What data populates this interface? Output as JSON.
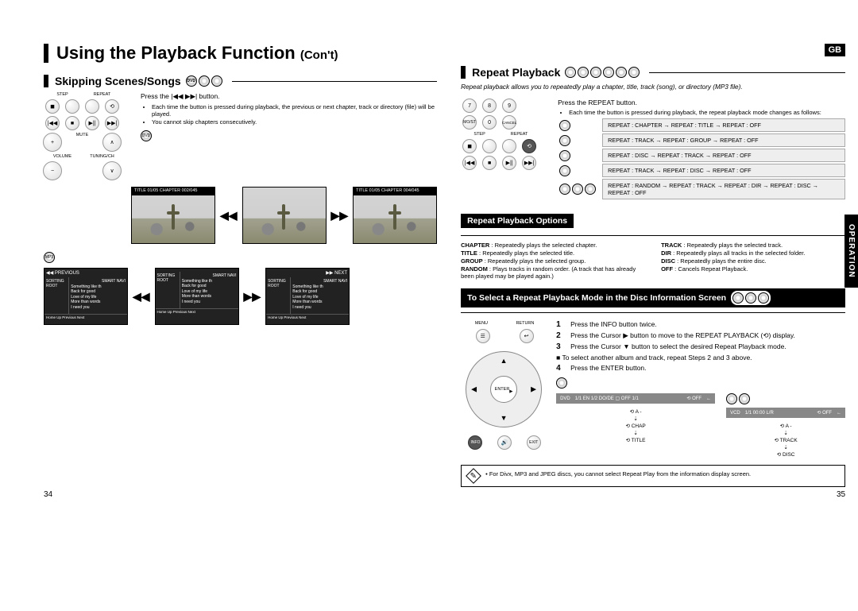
{
  "header": {
    "title": "Using the Playback Function",
    "cont": "(Con't)",
    "gb": "GB",
    "operation": "OPERATION"
  },
  "skip": {
    "heading": "Skipping Scenes/Songs",
    "press": "Press the |◀◀ ▶▶| button.",
    "bullet1": "Each time the button is pressed during playback, the previous or next chapter, track or directory (file) will be played.",
    "bullet2": "You cannot skip chapters consecutively.",
    "barTitle1": "TITLE 01/05 CHAPTER 002/045",
    "barTitle2": "TITLE 01/05 CHAPTER 004/045",
    "prevLabel": "◀◀ PREVIOUS",
    "nextLabel": "▶▶ NEXT",
    "menuCat1": "SORTING",
    "menuCat2": "ROOT",
    "menuCat3": "SMART NAVI",
    "menuItem1": "Something like th",
    "menuItem2": "Back for good",
    "menuItem3": "Love of my life",
    "menuItem4": "More than words",
    "menuItem5": "I need you",
    "menuFooter": "Home    Up    Previous    Next"
  },
  "repeat": {
    "heading": "Repeat Playback",
    "intro": "Repeat playback allows you to repeatedly play a chapter, title, track (song), or directory (MP3 file).",
    "press": "Press the REPEAT button.",
    "bullet1": "Each time the button is pressed during playback, the repeat playback mode changes as follows:",
    "seq1": "REPEAT : CHAPTER → REPEAT : TITLE → REPEAT : OFF",
    "seq2": "REPEAT : TRACK → REPEAT : GROUP → REPEAT : OFF",
    "seq3": "REPEAT : DISC → REPEAT : TRACK → REPEAT : OFF",
    "seq4": "REPEAT : TRACK → REPEAT : DISC → REPEAT : OFF",
    "seq5": "REPEAT : RANDOM → REPEAT : TRACK → REPEAT : DIR → REPEAT : DISC → REPEAT : OFF",
    "optionsHeading": "Repeat Playback Options",
    "opt_chapter": "Repeatedly plays the selected chapter.",
    "opt_title": "Repeatedly plays the selected title.",
    "opt_group": "Repeatedly plays the selected group.",
    "opt_random": "Plays tracks in random order. (A track that has already been played may be played again.)",
    "opt_track": "Repeatedly plays the selected track.",
    "opt_dir": "Repeatedly plays all tracks in the selected folder.",
    "opt_disc": "Repeatedly plays the entire disc.",
    "opt_off": "Cancels Repeat Playback.",
    "lbl_chapter": "CHAPTER",
    "lbl_title": "TITLE",
    "lbl_group": "GROUP",
    "lbl_random": "RANDOM",
    "lbl_track": "TRACK",
    "lbl_dir": "DIR",
    "lbl_disc": "DISC",
    "lbl_off": "OFF"
  },
  "select": {
    "heading": "To Select a Repeat Playback Mode in the Disc Information Screen",
    "step1": "Press the INFO button twice.",
    "step2": "Press the Cursor ▶ button to move to the REPEAT PLAYBACK (⟲) display.",
    "step3": "Press the Cursor ▼ button to select the desired Repeat Playback mode.",
    "step3sub": "To select another album and track, repeat Steps 2 and 3 above.",
    "step4": "Press the ENTER button.",
    "osd1_a": "DVD",
    "osd1_b": "1/1   EN 1/2   DO/DE   ▢ OFF   1/1",
    "osd1_c": "⟲ OFF",
    "osd2_a": "VCD",
    "osd2_b": "1/1   00:00   L/R",
    "osd2_c": "⟲ OFF",
    "labels1_a": "⟲ A -",
    "labels1_b": "⟲ CHAP",
    "labels1_c": "⟲ TITLE",
    "labels2_a": "⟲ A -",
    "labels2_b": "⟲ TRACK",
    "labels2_c": "⟲ DISC",
    "note": "For Divx, MP3 and JPEG discs, you cannot select Repeat Play from the information display screen."
  },
  "remote": {
    "step": "STEP",
    "repeat": "REPEAT",
    "mute": "MUTE",
    "volume": "VOLUME",
    "tuning": "TUNING/CH",
    "menu": "MENU",
    "return": "RETURN",
    "enter": "ENTER",
    "info": "INFO",
    "exit": "EXIT",
    "mo": "MO/ST",
    "cancel": "CANCEL"
  },
  "pages": {
    "left": "34",
    "right": "35"
  }
}
